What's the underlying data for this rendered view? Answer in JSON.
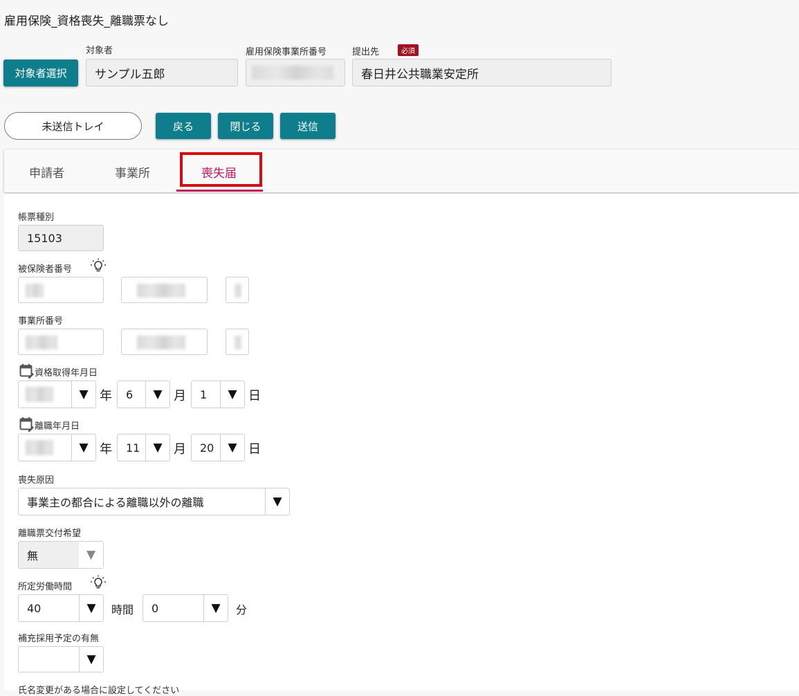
{
  "header": {
    "title": "雇用保険_資格喪失_離職票なし",
    "select_target_button": "対象者選択",
    "target_label": "対象者",
    "target_value": "サンプル五郎",
    "office_number_label": "雇用保険事業所番号",
    "submit_to_label": "提出先",
    "required_badge": "必須",
    "submit_to_value": "春日井公共職業安定所"
  },
  "actions": {
    "unsent_tray": "未送信トレイ",
    "back": "戻る",
    "close": "閉じる",
    "send": "送信"
  },
  "tabs": [
    {
      "label": "申請者",
      "active": false
    },
    {
      "label": "事業所",
      "active": false
    },
    {
      "label": "喪失届",
      "active": true
    }
  ],
  "form": {
    "form_type_label": "帳票種別",
    "form_type_value": "15103",
    "insured_number_label": "被保険者番号",
    "office_number_label": "事業所番号",
    "acquisition_date_label": "資格取得年月日",
    "acquisition_month": "6",
    "acquisition_day": "1",
    "separation_date_label": "離職年月日",
    "separation_month": "11",
    "separation_day": "20",
    "year_unit": "年",
    "month_unit": "月",
    "day_unit": "日",
    "loss_reason_label": "喪失原因",
    "loss_reason_value": "事業主の都合による離職以外の離職",
    "separation_slip_label": "離職票交付希望",
    "separation_slip_value": "無",
    "work_hours_label": "所定労働時間",
    "work_hours_value": "40",
    "hours_unit": "時間",
    "work_minutes_value": "0",
    "minutes_unit": "分",
    "replacement_label": "補充採用予定の有無",
    "replacement_value": "",
    "name_change_note": "氏名変更がある場合に設定してください"
  },
  "colors": {
    "accent": "#0e7d8c",
    "active_tab": "#c2185b",
    "highlight": "#d70b0b",
    "required": "#a3101f"
  },
  "icons": {
    "hint": "lightbulb-icon",
    "calendar": "calendar-edit-icon",
    "dropdown": "triangle-down-icon"
  }
}
